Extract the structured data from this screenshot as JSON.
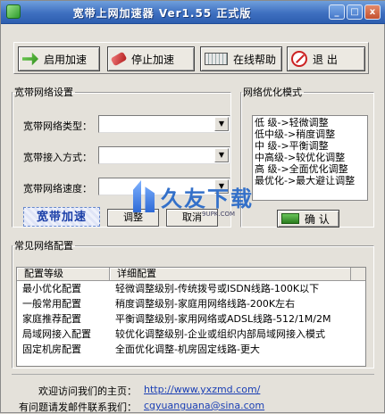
{
  "window": {
    "title": "宽带上网加速器  Ver1.55 正式版",
    "minimize": "_",
    "maximize": "□",
    "close": "x"
  },
  "toolbar": {
    "start_label": "启用加速",
    "stop_label": "停止加速",
    "help_label": "在线帮助",
    "exit_label": "退  出"
  },
  "settings": {
    "legend": "宽带网络设置",
    "type_label": "宽带网络类型：",
    "access_label": "宽带接入方式：",
    "speed_label": "宽带网络速度：",
    "type_value": "",
    "access_value": "",
    "speed_value": "",
    "badge": "宽带加速",
    "apply_label": "调整",
    "cancel_label": "取消"
  },
  "optimize": {
    "legend": "网络优化模式",
    "items": [
      "低  级->轻微调整",
      "低中级->稍度调整",
      "中  级->平衡调整",
      "中高级->较优化调整",
      "高  级->全面优化调整",
      "最优化->最大避让调整"
    ],
    "confirm_label": "确 认"
  },
  "network": {
    "legend": "常见网络配置",
    "headers": [
      "配置等级",
      "详细配置"
    ],
    "rows": [
      [
        "最小优化配置",
        "轻微调整级别-传统拨号或ISDN线路-100K以下"
      ],
      [
        "一般常用配置",
        "稍度调整级别-家庭用网络线路-200K左右"
      ],
      [
        "家庭推荐配置",
        "平衡调整级别-家用网络或ADSL线路-512/1M/2M"
      ],
      [
        "局域网接入配置",
        "较优化调整级别-企业或组织内部局域网接入模式"
      ],
      [
        "固定机房配置",
        "全面优化调整-机房固定线路-更大"
      ]
    ]
  },
  "footer": {
    "home_label": "欢迎访问我们的主页：",
    "home_link": "http://www.yxzmd.com/",
    "mail_label": "有问题请发邮件联系我们：",
    "mail_link": "cgyuanguana@sina.com"
  },
  "watermark": {
    "text": "久友下载",
    "url": "9UPK.COM"
  },
  "colors": {
    "titlebar": "#3e6fc0",
    "link": "#1a3fb5",
    "window_bg": "#e4e1da"
  }
}
